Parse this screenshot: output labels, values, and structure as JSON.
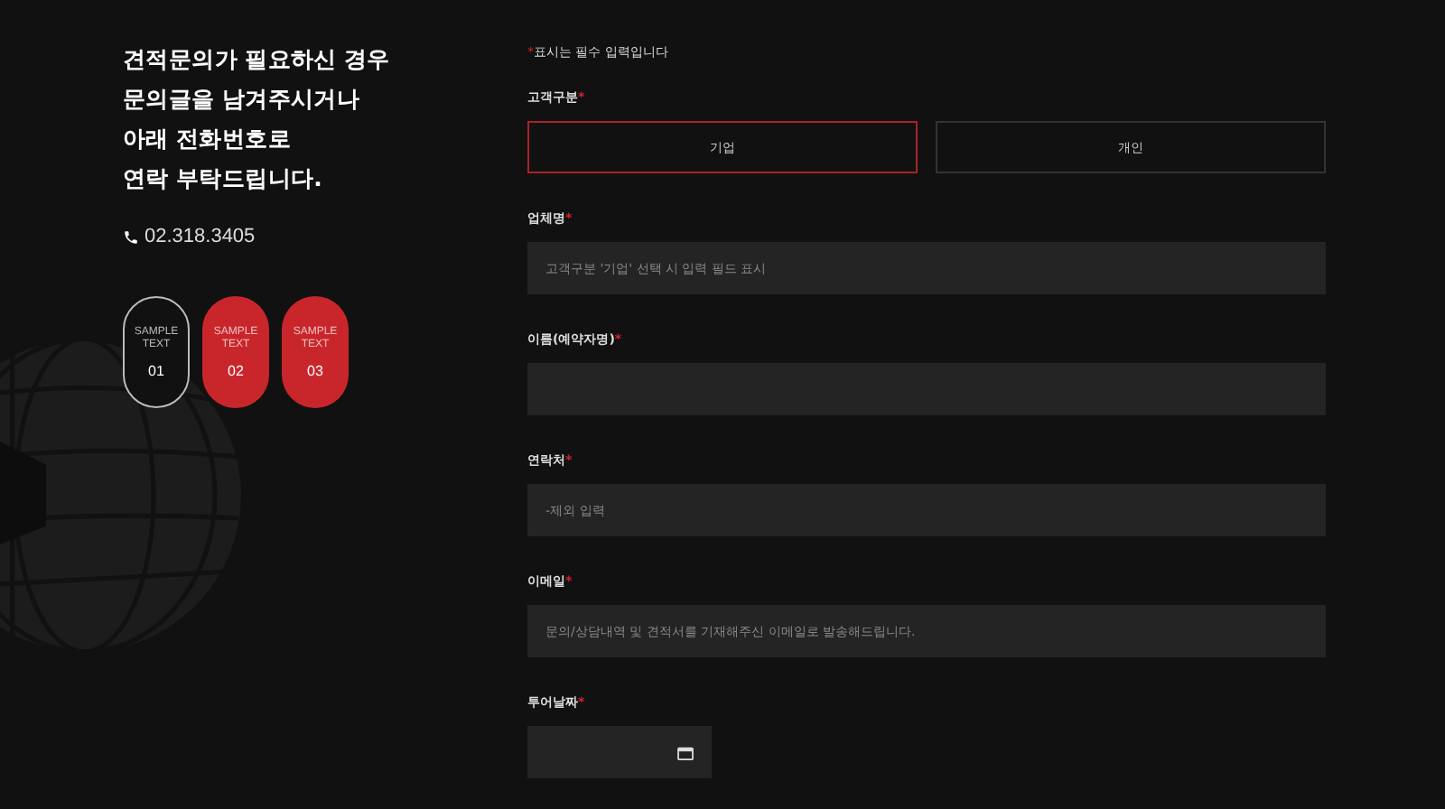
{
  "intro": {
    "headline_lines": [
      "견적문의가 필요하신 경우",
      "문의글을 남겨주시거나",
      "아래 전화번호로",
      "연락 부탁드립니다."
    ],
    "phone": "02.318.3405"
  },
  "steps": [
    {
      "label": "SAMPLE TEXT",
      "number": "01",
      "selected": true
    },
    {
      "label": "SAMPLE TEXT",
      "number": "02",
      "selected": false
    },
    {
      "label": "SAMPLE TEXT",
      "number": "03",
      "selected": false
    }
  ],
  "form": {
    "required_note": "표시는 필수 입력입니다",
    "required_mark": "*",
    "customer_type": {
      "label": "고객구분",
      "required": true,
      "options": [
        {
          "label": "기업",
          "selected": true
        },
        {
          "label": "개인",
          "selected": false
        }
      ]
    },
    "fields": [
      {
        "kind": "text",
        "label": "업체명",
        "required": true,
        "placeholder": "고객구분 '기업' 선택 시 입력 필드 표시"
      },
      {
        "kind": "text",
        "label": "이름(예약자명)",
        "required": true
      },
      {
        "kind": "text",
        "label": "연락처",
        "required": true,
        "placeholder": "-제외 입력"
      },
      {
        "kind": "text",
        "label": "이메일",
        "required": true,
        "placeholder": "문의/상담내역 및 견적서를 기재해주신 이메일로 발송해드립니다."
      },
      {
        "kind": "date",
        "label": "투어날짜",
        "required": true
      }
    ]
  }
}
